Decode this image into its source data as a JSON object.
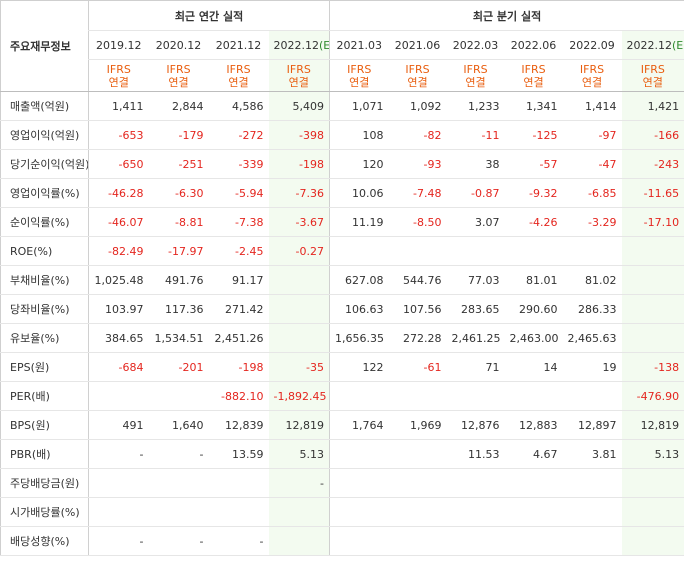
{
  "header": {
    "label_col": "주요재무정보",
    "annual_group": "최근 연간 실적",
    "quarter_group": "최근 분기 실적",
    "annual_periods": [
      "2019.12",
      "2020.12",
      "2021.12",
      "2022.12"
    ],
    "annual_est_marker": "(E)",
    "quarter_periods": [
      "2021.03",
      "2021.06",
      "2022.03",
      "2022.06",
      "2022.09",
      "2022.12"
    ],
    "quarter_est_marker": "(E)",
    "std_line1": "IFRS",
    "std_line2": "연결"
  },
  "rows": [
    {
      "label": "매출액(억원)",
      "cells": [
        "1,411",
        "2,844",
        "4,586",
        "5,409",
        "1,071",
        "1,092",
        "1,233",
        "1,341",
        "1,414",
        "1,421"
      ]
    },
    {
      "label": "영업이익(억원)",
      "cells": [
        "-653",
        "-179",
        "-272",
        "-398",
        "108",
        "-82",
        "-11",
        "-125",
        "-97",
        "-166"
      ]
    },
    {
      "label": "당기순이익(억원)",
      "cells": [
        "-650",
        "-251",
        "-339",
        "-198",
        "120",
        "-93",
        "38",
        "-57",
        "-47",
        "-243"
      ]
    },
    {
      "label": "영업이익률(%)",
      "cells": [
        "-46.28",
        "-6.30",
        "-5.94",
        "-7.36",
        "10.06",
        "-7.48",
        "-0.87",
        "-9.32",
        "-6.85",
        "-11.65"
      ]
    },
    {
      "label": "순이익률(%)",
      "cells": [
        "-46.07",
        "-8.81",
        "-7.38",
        "-3.67",
        "11.19",
        "-8.50",
        "3.07",
        "-4.26",
        "-3.29",
        "-17.10"
      ]
    },
    {
      "label": "ROE(%)",
      "cells": [
        "-82.49",
        "-17.97",
        "-2.45",
        "-0.27",
        "",
        "",
        "",
        "",
        "",
        ""
      ]
    },
    {
      "label": "부채비율(%)",
      "cells": [
        "1,025.48",
        "491.76",
        "91.17",
        "",
        "627.08",
        "544.76",
        "77.03",
        "81.01",
        "81.02",
        ""
      ]
    },
    {
      "label": "당좌비율(%)",
      "cells": [
        "103.97",
        "117.36",
        "271.42",
        "",
        "106.63",
        "107.56",
        "283.65",
        "290.60",
        "286.33",
        ""
      ]
    },
    {
      "label": "유보율(%)",
      "cells": [
        "384.65",
        "1,534.51",
        "2,451.26",
        "",
        "1,656.35",
        "272.28",
        "2,461.25",
        "2,463.00",
        "2,465.63",
        ""
      ]
    },
    {
      "label": "EPS(원)",
      "cells": [
        "-684",
        "-201",
        "-198",
        "-35",
        "122",
        "-61",
        "71",
        "14",
        "19",
        "-138"
      ]
    },
    {
      "label": "PER(배)",
      "cells": [
        "",
        "",
        "-882.10",
        "-1,892.45",
        "",
        "",
        "",
        "",
        "",
        "-476.90"
      ]
    },
    {
      "label": "BPS(원)",
      "cells": [
        "491",
        "1,640",
        "12,839",
        "12,819",
        "1,764",
        "1,969",
        "12,876",
        "12,883",
        "12,897",
        "12,819"
      ]
    },
    {
      "label": "PBR(배)",
      "cells": [
        "-",
        "-",
        "13.59",
        "5.13",
        "",
        "",
        "11.53",
        "4.67",
        "3.81",
        "5.13"
      ]
    },
    {
      "label": "주당배당금(원)",
      "cells": [
        "",
        "",
        "",
        "-",
        "",
        "",
        "",
        "",
        "",
        ""
      ]
    },
    {
      "label": "시가배당률(%)",
      "cells": [
        "",
        "",
        "",
        "",
        "",
        "",
        "",
        "",
        "",
        ""
      ]
    },
    {
      "label": "배당성향(%)",
      "cells": [
        "-",
        "-",
        "-",
        "",
        "",
        "",
        "",
        "",
        "",
        ""
      ]
    }
  ],
  "colors": {
    "negative": "#e4261f",
    "standard": "#e95e0f",
    "estimate_bg": "#f3fbf0",
    "estimate_text": "#2f8a2f"
  }
}
